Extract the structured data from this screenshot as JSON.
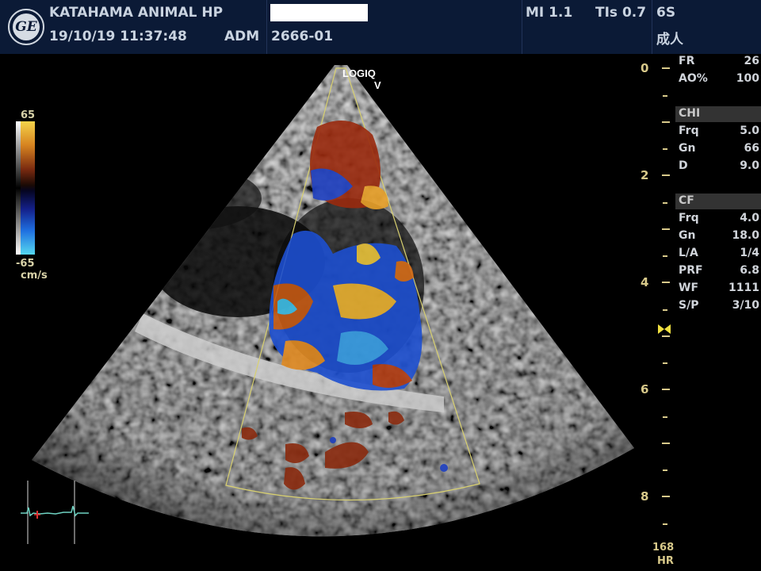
{
  "header": {
    "logo_text": "GE",
    "clinic": "KATAHAMA ANIMAL HP",
    "datetime": "19/10/19 11:37:48",
    "operator": "ADM",
    "patient_id": "2666-01",
    "mi": "MI 1.1",
    "tis": "TIs 0.7",
    "probe": "6S",
    "preset": "成人"
  },
  "scan": {
    "brand": "LOGIQ",
    "brand_sub": "V"
  },
  "colorbar": {
    "max": "65",
    "min": "-65",
    "unit": "cm/s"
  },
  "params": {
    "fr_label": "FR",
    "fr_value": "26",
    "ao_label": "AO%",
    "ao_value": "100",
    "chi_label": "CHI",
    "chi_frq_label": "Frq",
    "chi_frq_value": "5.0",
    "chi_gn_label": "Gn",
    "chi_gn_value": "66",
    "chi_d_label": "D",
    "chi_d_value": "9.0",
    "cf_label": "CF",
    "cf_frq_label": "Frq",
    "cf_frq_value": "4.0",
    "cf_gn_label": "Gn",
    "cf_gn_value": "18.0",
    "la_label": "L/A",
    "la_value": "1/4",
    "prf_label": "PRF",
    "prf_value": "6.8",
    "wf_label": "WF",
    "wf_value": "1111",
    "sp_label": "S/P",
    "sp_value": "3/10"
  },
  "depth_scale": {
    "labels": [
      "0",
      "2",
      "4",
      "6",
      "8"
    ]
  },
  "heart_rate": {
    "value": "168",
    "label": "HR"
  },
  "colors": {
    "header_bg": "#0b1a36",
    "depth_marks": "#d8c98a",
    "color_box_outline": "#d8d070",
    "ecg_trace": "#6fd3c3"
  }
}
